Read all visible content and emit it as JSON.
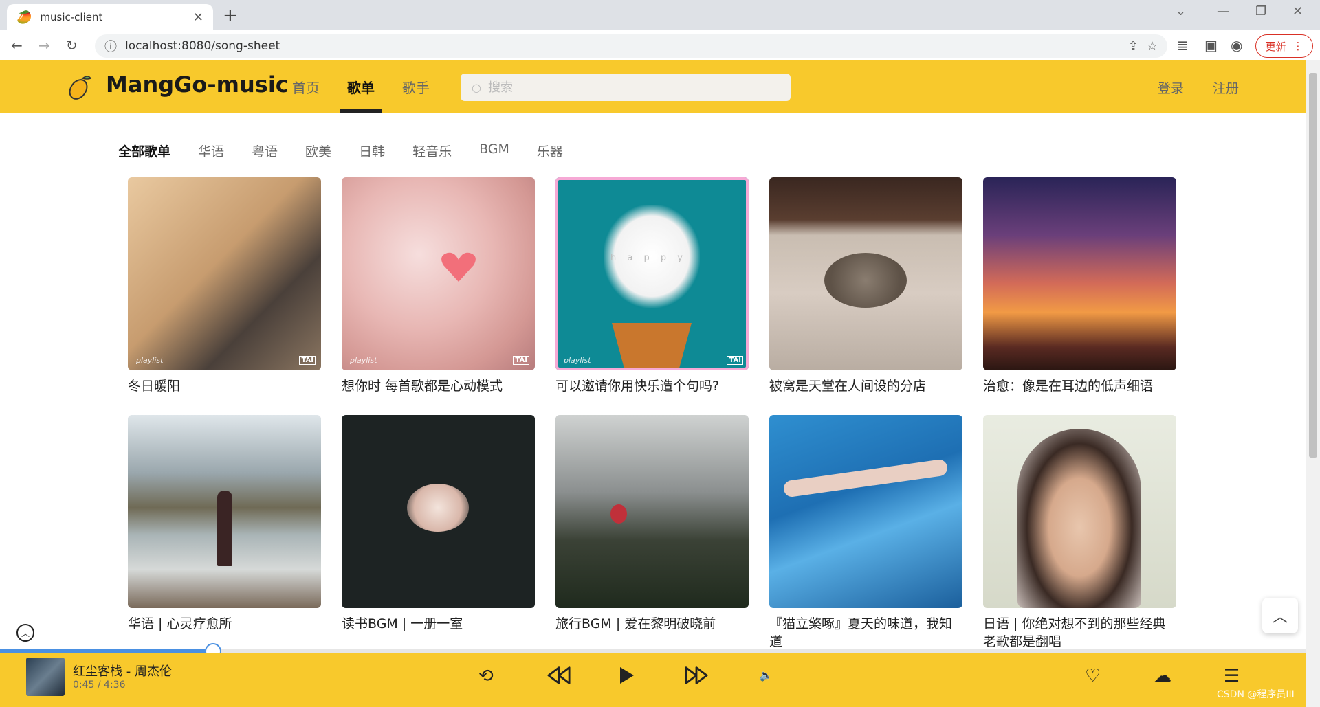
{
  "browser": {
    "tab_title": "music-client",
    "url": "localhost:8080/song-sheet",
    "update_label": "更新"
  },
  "header": {
    "app_title": "MangGo-music",
    "nav": [
      "首页",
      "歌单",
      "歌手"
    ],
    "search_placeholder": "搜索",
    "login": "登录",
    "register": "注册"
  },
  "categories": [
    "全部歌单",
    "华语",
    "粤语",
    "欧美",
    "日韩",
    "轻音乐",
    "BGM",
    "乐器"
  ],
  "playlists": [
    {
      "name": "冬日暖阳",
      "tag": "playlist",
      "badge": "TAI"
    },
    {
      "name": "想你时 每首歌都是心动模式",
      "tag": "playlist",
      "badge": "TAI"
    },
    {
      "name": "可以邀请你用快乐造个句吗?",
      "tag": "playlist",
      "badge": "TAI",
      "cover_text": "h a p p y"
    },
    {
      "name": "被窝是天堂在人间设的分店"
    },
    {
      "name": "治愈：像是在耳边的低声细语"
    },
    {
      "name": "华语 | 心灵疗愈所"
    },
    {
      "name": "读书BGM | 一册一室"
    },
    {
      "name": "旅行BGM | 爱在黎明破晓前"
    },
    {
      "name": "『猫立檠啄』夏天的味道，我知道"
    },
    {
      "name": "日语 | 你绝对想不到的那些经典老歌都是翻唱"
    }
  ],
  "player": {
    "song": "红尘客栈 - 周杰伦",
    "time": "0:45 / 4:36",
    "progress": 0.163
  },
  "watermark": "CSDN @程序员III"
}
